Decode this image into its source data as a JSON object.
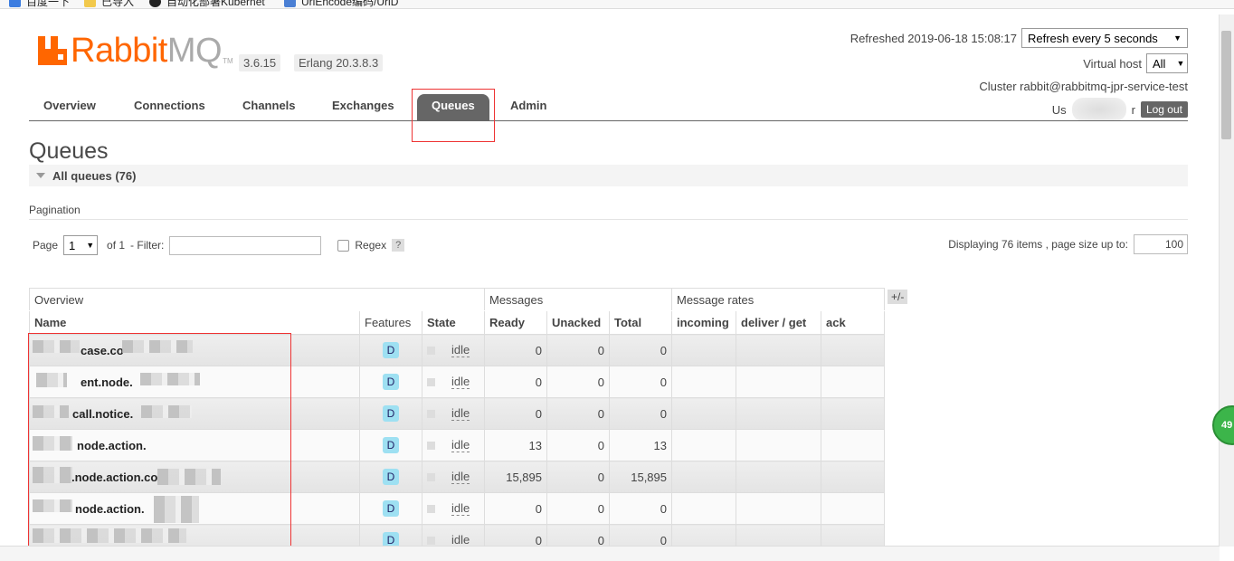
{
  "bookmarks": [
    {
      "label": "百度一下",
      "icon": "baidu-icon"
    },
    {
      "label": "已导入",
      "icon": "folder-icon"
    },
    {
      "label": "自动化部署Kubernet",
      "icon": "github-icon"
    },
    {
      "label": "UrlEncode编码/UrlD",
      "icon": "bookmark-icon"
    }
  ],
  "header": {
    "logo_main": "Rabbit",
    "logo_mq": "MQ",
    "logo_tm": "TM",
    "version": "3.6.15",
    "erlang": "Erlang 20.3.8.3",
    "refreshed": "Refreshed 2019-06-18 15:08:17",
    "refresh_select": "Refresh every 5 seconds",
    "vhost_label": "Virtual host",
    "vhost_select": "All",
    "cluster": "Cluster rabbit@rabbitmq-jpr-service-test",
    "user_prefix": "Us",
    "user_suffix": "r",
    "logout": "Log out"
  },
  "nav": {
    "tabs": [
      {
        "label": "Overview"
      },
      {
        "label": "Connections"
      },
      {
        "label": "Channels"
      },
      {
        "label": "Exchanges"
      },
      {
        "label": "Queues",
        "active": true
      },
      {
        "label": "Admin"
      }
    ]
  },
  "page": {
    "title": "Queues",
    "section": "All queues (76)",
    "pagination_label": "Pagination",
    "page_label": "Page",
    "page_value": "1",
    "of_label": "of 1",
    "filter_label": "- Filter:",
    "regex_label": "Regex",
    "help": "?",
    "displaying": "Displaying 76 items , page size up to:",
    "page_size": "100",
    "toggle_cols": "+/-"
  },
  "table": {
    "groups": [
      "Overview",
      "Messages",
      "Message rates"
    ],
    "headers": [
      "Name",
      "Features",
      "State",
      "Ready",
      "Unacked",
      "Total",
      "incoming",
      "deliver / get",
      "ack"
    ],
    "rows": [
      {
        "name": "case.co",
        "feature": "D",
        "state": "idle",
        "ready": "0",
        "unacked": "0",
        "total": "0"
      },
      {
        "name": "ent.node.",
        "feature": "D",
        "state": "idle",
        "ready": "0",
        "unacked": "0",
        "total": "0"
      },
      {
        "name": "call.notice.",
        "feature": "D",
        "state": "idle",
        "ready": "0",
        "unacked": "0",
        "total": "0"
      },
      {
        "name": "node.action.",
        "feature": "D",
        "state": "idle",
        "ready": "13",
        "unacked": "0",
        "total": "13"
      },
      {
        "name": ".node.action.co",
        "feature": "D",
        "state": "idle",
        "ready": "15,895",
        "unacked": "0",
        "total": "15,895"
      },
      {
        "name": "node.action.",
        "feature": "D",
        "state": "idle",
        "ready": "0",
        "unacked": "0",
        "total": "0"
      },
      {
        "name": "",
        "feature": "D",
        "state": "idle",
        "ready": "0",
        "unacked": "0",
        "total": "0"
      }
    ]
  },
  "side_badge": "49",
  "colors": {
    "brand": "#ff6600",
    "tab_active": "#666666",
    "highlight": "#e33333",
    "badge": "#9ee0f2"
  }
}
